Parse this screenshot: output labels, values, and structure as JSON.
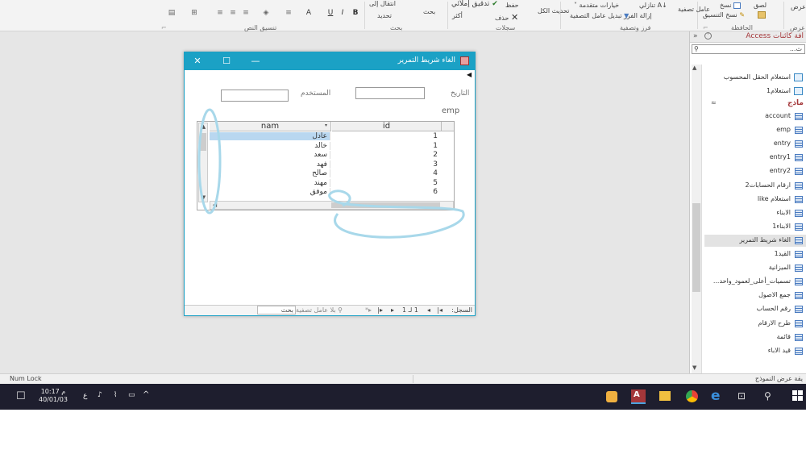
{
  "ribbon": {
    "groups": {
      "clipboard": "الحافظة",
      "sort_filter": "فرز وتصفية",
      "records": "سجلات",
      "find": "بحث",
      "text_formatting": "تنسيق النص",
      "views_partial": "ك عرض"
    },
    "clipboard": {
      "copy": "نسخ",
      "format_painter": "نسخ التنسيق",
      "paste": "لصق",
      "views": "عرض"
    },
    "sort_filter": {
      "filter": "عامل تصفية",
      "ascending": "تنازلي",
      "advanced": "خيارات متقدمة",
      "remove_sort": "إزالة الفرز",
      "toggle_filter": "تبديل عامل التصفية"
    },
    "records": {
      "refresh_all": "تحديث الكل",
      "save": "حفظ",
      "delete": "حذف",
      "more": "أكثر",
      "spelling": "تدقيق إملائي"
    },
    "find": {
      "find": "بحث",
      "goto": "انتقال إلى",
      "select": "تحديد"
    },
    "text_formatting": {
      "bold": "B",
      "italic": "I",
      "underline": "U",
      "font_color": "A"
    }
  },
  "nav_pane": {
    "title": "افة كائنات Access",
    "search_placeholder": "ث...",
    "section_forms": "ماذج",
    "items_top": [
      {
        "label": "استعلام الحقل المحسوب",
        "icon": "query-icon"
      },
      {
        "label": "استعلام1",
        "icon": "query-icon"
      }
    ],
    "forms": [
      {
        "label": "account"
      },
      {
        "label": "emp"
      },
      {
        "label": "entry"
      },
      {
        "label": "entry1"
      },
      {
        "label": "entry2"
      },
      {
        "label": "ارقام الحسابات2"
      },
      {
        "label": "استعلام like"
      },
      {
        "label": "الابناء"
      },
      {
        "label": "الابناء1"
      },
      {
        "label": "الغاء شريط التمرير",
        "selected": true
      },
      {
        "label": "القيد1"
      },
      {
        "label": "الميزانية"
      },
      {
        "label": "تسميات_أعلى_لعمود_واحد..."
      },
      {
        "label": "جمع الاصول"
      },
      {
        "label": "رقم الحساب"
      },
      {
        "label": "طرح الارقام"
      },
      {
        "label": "قائمة"
      },
      {
        "label": "قيد الاباء"
      }
    ]
  },
  "form": {
    "title": "الغاء شريط التمرير",
    "date_label": "التاريخ",
    "user_label": "المستخدم",
    "subform_label": "emp",
    "grid": {
      "col_name": "nam",
      "col_id": "id",
      "rows": [
        {
          "nam": "عادل",
          "id": "1",
          "selected": true
        },
        {
          "nam": "خالد",
          "id": "1"
        },
        {
          "nam": "سعد",
          "id": "2"
        },
        {
          "nam": "فهد",
          "id": "3"
        },
        {
          "nam": "صالح",
          "id": "4"
        },
        {
          "nam": "مهند",
          "id": "5"
        },
        {
          "nam": "موفق",
          "id": "6"
        }
      ]
    },
    "record_nav": {
      "label": "السجل:",
      "position": "1 لـ 1",
      "no_filter": "بلا عامل تصفية",
      "search": "بحث"
    }
  },
  "status_bar": {
    "left": "Num Lock",
    "right": "يقة عرض النموذج"
  },
  "taskbar": {
    "time": "10:17",
    "ampm": "م",
    "date": "40/01/03",
    "lang": "ع"
  },
  "colors": {
    "title_bar": "#1ba1c5",
    "annotation": "#a8d8ea",
    "nav_title": "#a4373a"
  }
}
